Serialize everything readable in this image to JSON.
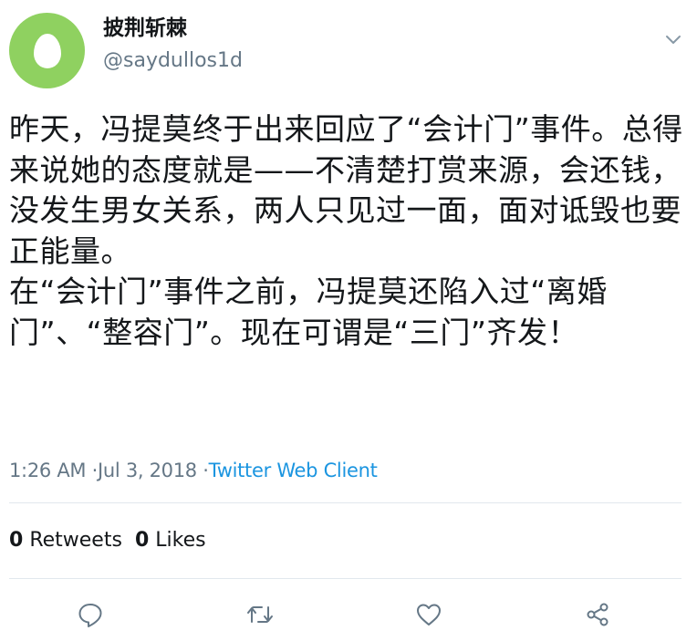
{
  "user": {
    "display_name": "披荆斩棘",
    "handle": "@saydullos1d",
    "avatar_color": "#8fd160"
  },
  "tweet": {
    "text": "昨天，冯提莫终于出来回应了“会计门”事件。总得来说她的态度就是——不清楚打赏来源，会还钱，没发生男女关系，两人只见过一面，面对诋毁也要正能量。\n在“会计门”事件之前，冯提莫还陷入过“离婚门”、“整容门”。现在可谓是“三门”齐发！",
    "time": "1:26 AM",
    "separator1": "·",
    "date": "Jul 3, 2018",
    "separator2": "·",
    "source": "Twitter Web Client"
  },
  "stats": {
    "retweets_count": "0",
    "retweets_label": "Retweets",
    "likes_count": "0",
    "likes_label": "Likes"
  },
  "icons": {
    "menu": "chevron-down-icon",
    "reply": "reply-icon",
    "retweet": "retweet-icon",
    "like": "heart-icon",
    "share": "share-icon"
  },
  "colors": {
    "text": "#14171a",
    "secondary": "#657786",
    "link": "#1b95e0",
    "divider": "#e1e8ed"
  }
}
